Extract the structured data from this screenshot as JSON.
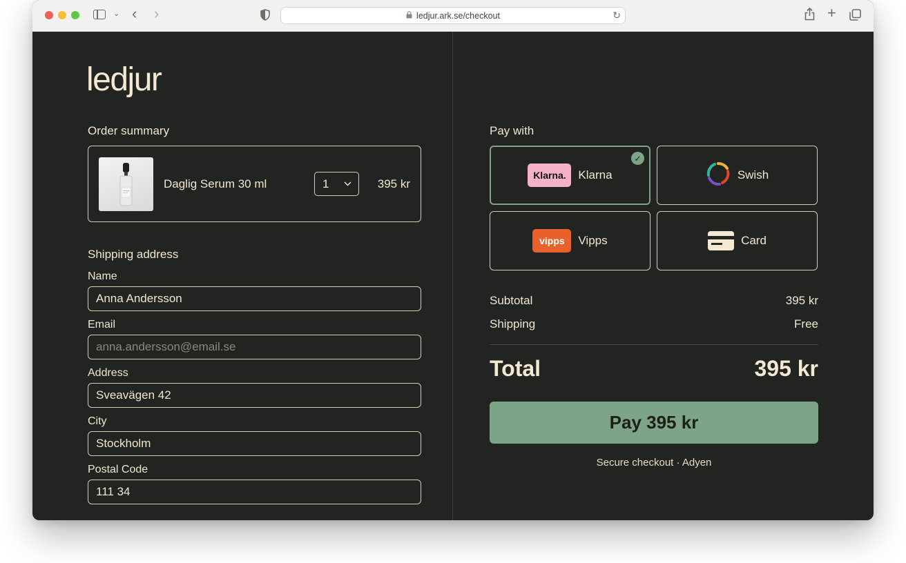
{
  "browser": {
    "url": "ledjur.ark.se/checkout"
  },
  "brand": {
    "logo_text": "ledjur"
  },
  "order": {
    "title": "Order summary",
    "product_name": "Daglig Serum 30 ml",
    "quantity": "1",
    "price": "395 kr"
  },
  "shipping": {
    "title": "Shipping address",
    "name_label": "Name",
    "name_value": "Anna Andersson",
    "email_label": "Email",
    "email_placeholder": "anna.andersson@email.se",
    "address_label": "Address",
    "address_value": "Sveavägen 42",
    "city_label": "City",
    "city_value": "Stockholm",
    "postal_label": "Postal Code",
    "postal_value": "111 34"
  },
  "payment": {
    "title": "Pay with",
    "options": [
      {
        "label": "Klarna",
        "logo_text": "Klarna.",
        "selected": true
      },
      {
        "label": "Swish",
        "selected": false
      },
      {
        "label": "Vipps",
        "logo_text": "vipps",
        "selected": false
      },
      {
        "label": "Card",
        "selected": false
      }
    ]
  },
  "summary": {
    "subtotal_label": "Subtotal",
    "subtotal_value": "395 kr",
    "shipping_label": "Shipping",
    "shipping_value": "Free",
    "total_label": "Total",
    "total_value": "395 kr",
    "pay_button": "Pay 395 kr",
    "secure_note": "Secure checkout · Adyen"
  },
  "colors": {
    "background": "#222421",
    "accent": "#7da487",
    "text": "#f1e6d0",
    "klarna_pink": "#f5b1c7",
    "vipps_orange": "#e8612d"
  },
  "icons": {
    "sidebar": "sidebar-icon",
    "back": "back-icon",
    "forward": "forward-icon",
    "shield": "shield-icon",
    "lock": "lock-icon",
    "reload": "reload-icon",
    "share": "share-icon",
    "new_tab": "plus-icon",
    "tabs": "tabs-overview-icon",
    "check": "check-icon",
    "chevron": "chevron-down-icon"
  }
}
